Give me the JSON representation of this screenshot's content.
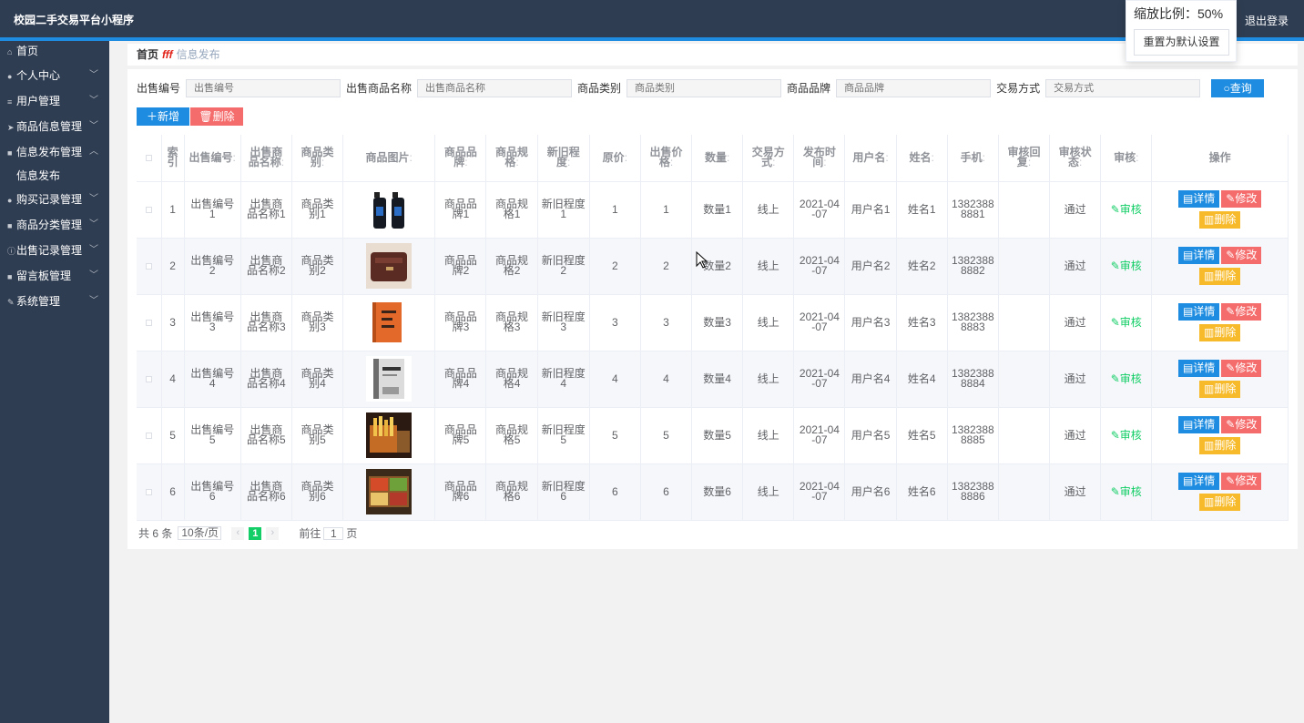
{
  "app": {
    "title": "校园二手交易平台小程序",
    "logout": "退出登录"
  },
  "zoom": {
    "label": "缩放比例：50%",
    "reset": "重置为默认设置"
  },
  "sidebar": {
    "items": [
      {
        "label": "首页",
        "icon": "home-icon"
      },
      {
        "label": "个人中心",
        "icon": "user-icon"
      },
      {
        "label": "用户管理",
        "icon": "list-icon"
      },
      {
        "label": "商品信息管理",
        "icon": "send-icon"
      },
      {
        "label": "信息发布管理",
        "icon": "doc-icon",
        "open": true
      },
      {
        "label": "购买记录管理",
        "icon": "user-icon"
      },
      {
        "label": "商品分类管理",
        "icon": "doc-icon"
      },
      {
        "label": "出售记录管理",
        "icon": "info-icon"
      },
      {
        "label": "留言板管理",
        "icon": "doc-icon"
      },
      {
        "label": "系统管理",
        "icon": "edit-icon"
      }
    ],
    "sub": {
      "label": "信息发布"
    }
  },
  "breadcrumb": {
    "home": "首页",
    "sep": "fff",
    "current": "信息发布"
  },
  "search": {
    "f1": {
      "label": "出售编号",
      "placeholder": "出售编号"
    },
    "f2": {
      "label": "出售商品名称",
      "placeholder": "出售商品名称"
    },
    "f3": {
      "label": "商品类别",
      "placeholder": "商品类别"
    },
    "f4": {
      "label": "商品品牌",
      "placeholder": "商品品牌"
    },
    "f5": {
      "label": "交易方式",
      "placeholder": "交易方式"
    },
    "query": "查询"
  },
  "actions": {
    "add": "新增",
    "delete": "删除"
  },
  "table": {
    "headers": {
      "index": "索引",
      "sale_no": "出售编号",
      "name": "出售商品名称",
      "category": "商品类别",
      "image": "商品图片",
      "brand": "商品品牌",
      "spec": "商品规格",
      "condition": "新旧程度",
      "orig_price": "原价",
      "price": "出售价格",
      "qty": "数量",
      "trade": "交易方式",
      "pub_time": "发布时间",
      "username": "用户名",
      "fullname": "姓名",
      "phone": "手机",
      "reply": "审核回复",
      "status": "审核状态",
      "audit": "审核",
      "ops": "操作"
    },
    "sort_mark": ":",
    "audit_label": "审核",
    "op_detail": "详情",
    "op_edit": "修改",
    "op_delete": "删除",
    "rows": [
      {
        "idx": "1",
        "sale_no": "出售编号1",
        "name": "出售商品名称1",
        "category": "商品类别1",
        "brand": "商品品牌1",
        "spec": "商品规格1",
        "condition": "新旧程度1",
        "orig": "1",
        "price": "1",
        "qty": "数量1",
        "trade": "线上",
        "time": "2021-04-07",
        "user": "用户名1",
        "full": "姓名1",
        "phone": "13823888881",
        "reply": "",
        "status": "通过",
        "img": "bottles"
      },
      {
        "idx": "2",
        "sale_no": "出售编号2",
        "name": "出售商品名称2",
        "category": "商品类别2",
        "brand": "商品品牌2",
        "spec": "商品规格2",
        "condition": "新旧程度2",
        "orig": "2",
        "price": "2",
        "qty": "数量2",
        "trade": "线上",
        "time": "2021-04-07",
        "user": "用户名2",
        "full": "姓名2",
        "phone": "13823888882",
        "reply": "",
        "status": "通过",
        "img": "bag"
      },
      {
        "idx": "3",
        "sale_no": "出售编号3",
        "name": "出售商品名称3",
        "category": "商品类别3",
        "brand": "商品品牌3",
        "spec": "商品规格3",
        "condition": "新旧程度3",
        "orig": "3",
        "price": "3",
        "qty": "数量3",
        "trade": "线上",
        "time": "2021-04-07",
        "user": "用户名3",
        "full": "姓名3",
        "phone": "13823888883",
        "reply": "",
        "status": "通过",
        "img": "book-orange"
      },
      {
        "idx": "4",
        "sale_no": "出售编号4",
        "name": "出售商品名称4",
        "category": "商品类别4",
        "brand": "商品品牌4",
        "spec": "商品规格4",
        "condition": "新旧程度4",
        "orig": "4",
        "price": "4",
        "qty": "数量4",
        "trade": "线上",
        "time": "2021-04-07",
        "user": "用户名4",
        "full": "姓名4",
        "phone": "13823888884",
        "reply": "",
        "status": "通过",
        "img": "book-gray"
      },
      {
        "idx": "5",
        "sale_no": "出售编号5",
        "name": "出售商品名称5",
        "category": "商品类别5",
        "brand": "商品品牌5",
        "spec": "商品规格5",
        "condition": "新旧程度5",
        "orig": "5",
        "price": "5",
        "qty": "数量5",
        "trade": "线上",
        "time": "2021-04-07",
        "user": "用户名5",
        "full": "姓名5",
        "phone": "13823888885",
        "reply": "",
        "status": "通过",
        "img": "fries"
      },
      {
        "idx": "6",
        "sale_no": "出售编号6",
        "name": "出售商品名称6",
        "category": "商品类别6",
        "brand": "商品品牌6",
        "spec": "商品规格6",
        "condition": "新旧程度6",
        "orig": "6",
        "price": "6",
        "qty": "数量6",
        "trade": "线上",
        "time": "2021-04-07",
        "user": "用户名6",
        "full": "姓名6",
        "phone": "13823888886",
        "reply": "",
        "status": "通过",
        "img": "bento"
      }
    ]
  },
  "pager": {
    "total": "共 6 条",
    "size": "10条/页",
    "page": "1",
    "goto": "前往",
    "goto_val": "1",
    "page_unit": "页"
  }
}
